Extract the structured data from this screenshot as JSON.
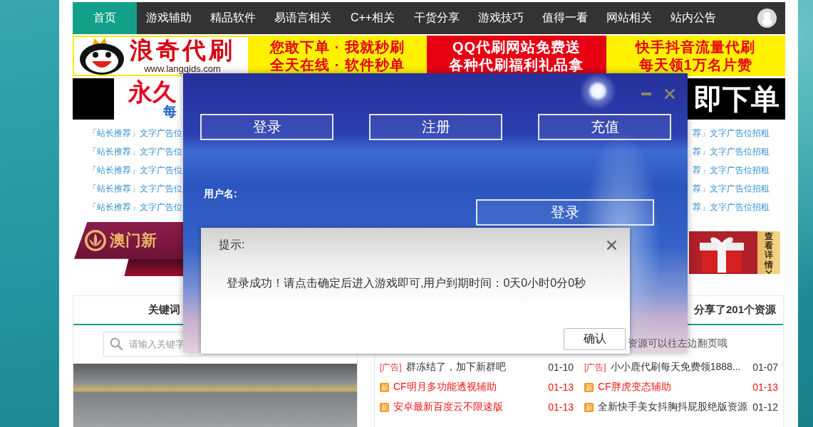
{
  "nav": {
    "items": [
      {
        "label": "首页",
        "selected": true
      },
      {
        "label": "游戏辅助",
        "selected": false
      },
      {
        "label": "精品软件",
        "selected": false
      },
      {
        "label": "易语言相关",
        "selected": false
      },
      {
        "label": "C++相关",
        "selected": false
      },
      {
        "label": "干货分享",
        "selected": false
      },
      {
        "label": "游戏技巧",
        "selected": false
      },
      {
        "label": "值得一看",
        "selected": false
      },
      {
        "label": "网站相关",
        "selected": false
      },
      {
        "label": "站内公告",
        "selected": false
      }
    ]
  },
  "top_banner": {
    "logo": {
      "title": "浪奇代刷",
      "url": "www.langqids.com"
    },
    "slogans": [
      {
        "color": "#fff200",
        "lines": [
          "您敢下单 · 我就秒刷",
          "全天在线 · 软件秒单"
        ]
      },
      {
        "color": "#e60012",
        "lines": [
          "QQ代刷网站免费送",
          "各种代刷福利礼品拿"
        ]
      },
      {
        "color": "#fff200",
        "lines": [
          "快手抖音流量代刷",
          "每天领1万名片赞"
        ]
      }
    ]
  },
  "second_banner": {
    "left_title": "永久",
    "left_subtitle": "每",
    "right_title": "即下单"
  },
  "text_ads": {
    "left": [
      "「站长推荐」文字广告位",
      "「站长推荐」文字广告位",
      "「站长推荐」文字广告位",
      "「站长推荐」文字广告位",
      "「站长推荐」文字广告位"
    ],
    "right": [
      "荐」文字广告位招租",
      "荐」文字广告位招租",
      "荐」文字广告位招租",
      "荐」文字广告位招租",
      "荐」文字广告位招租"
    ]
  },
  "image_ads": {
    "left": {
      "title": "澳门新"
    },
    "right": {
      "label": "查看详情"
    }
  },
  "keyword_panel": {
    "title": "关键词",
    "search": {
      "placeholder": "请输入关键字"
    }
  },
  "resources_panel": {
    "title": "分享了**201**个资源",
    "hint": "资源可以往左边翻页哦",
    "columns": [
      {
        "items": [
          {
            "kind": "ad",
            "tag": "[广告]",
            "title": "群冻结了，加下新群吧",
            "date": "01-10",
            "highlighted": false
          },
          {
            "kind": "new",
            "tag": "新",
            "title": "CF明月多功能透视辅助",
            "date": "01-13",
            "highlighted": true
          },
          {
            "kind": "new",
            "tag": "新",
            "title": "安卓最新百度云不限速版",
            "date": "01-13",
            "highlighted": true
          }
        ]
      },
      {
        "items": [
          {
            "kind": "ad",
            "tag": "[广告]",
            "title": "小小鹿代刷每天免费领1888...",
            "date": "01-07",
            "highlighted": false
          },
          {
            "kind": "new",
            "tag": "新",
            "title": "CF胖虎变态辅助",
            "date": "01-13",
            "highlighted": true
          },
          {
            "kind": "new",
            "tag": "新",
            "title": "全新快手美女抖胸抖屁股绝版资源",
            "date": "01-12",
            "highlighted": false
          }
        ]
      }
    ]
  },
  "app_window": {
    "buttons": [
      "登录",
      "注册",
      "充值"
    ],
    "username_label": "用户名:",
    "login_button": "登录"
  },
  "alert": {
    "title": "提示:",
    "message": "登录成功！请点击确定后进入游戏即可,用户到期时间：0天0小时0分0秒",
    "button": "确认"
  }
}
